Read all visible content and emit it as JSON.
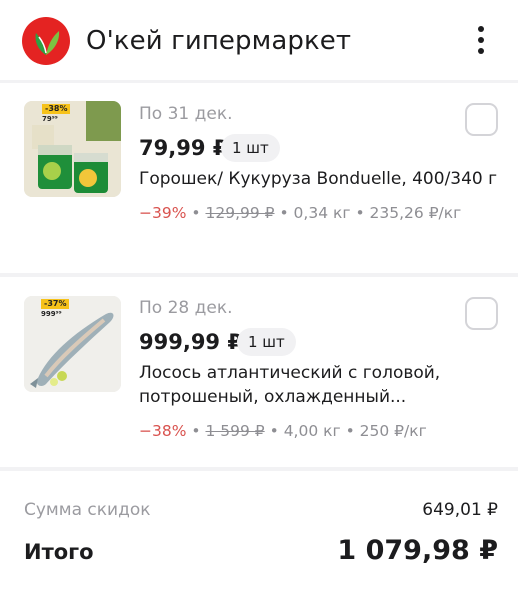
{
  "header": {
    "store_name": "О'кей гипермаркет",
    "logo_icon": "okey-logo-icon",
    "menu_icon": "more-vertical-icon"
  },
  "items": [
    {
      "date": "По 31 дек.",
      "price": "79,99 ₽",
      "quantity": "1 шт",
      "name": "Горошек/ Кукуруза Bonduelle, 400/340 г",
      "discount": "−39%",
      "old_price": "129,99 ₽",
      "weight": "0,34 кг",
      "unit_price": "235,26 ₽/кг",
      "thumb_badge": "-38%",
      "thumb_price": "79⁹⁹"
    },
    {
      "date": "По 28 дек.",
      "price": "999,99 ₽",
      "quantity": "1 шт",
      "name": "Лосось атлантический с головой, потрошеный, охлажденный...",
      "discount": "−38%",
      "old_price": "1 599 ₽",
      "weight": "4,00 кг",
      "unit_price": "250 ₽/кг",
      "thumb_badge": "-37%",
      "thumb_price": "999⁹⁹"
    }
  ],
  "summary": {
    "discount_label": "Сумма скидок",
    "discount_value": "649,01 ₽",
    "total_label": "Итого",
    "total_value": "1 079,98 ₽"
  },
  "colors": {
    "brand_red": "#e42322",
    "discount_red": "#d9534f",
    "muted_text": "#9b9ba0",
    "background": "#f2f2f4"
  }
}
